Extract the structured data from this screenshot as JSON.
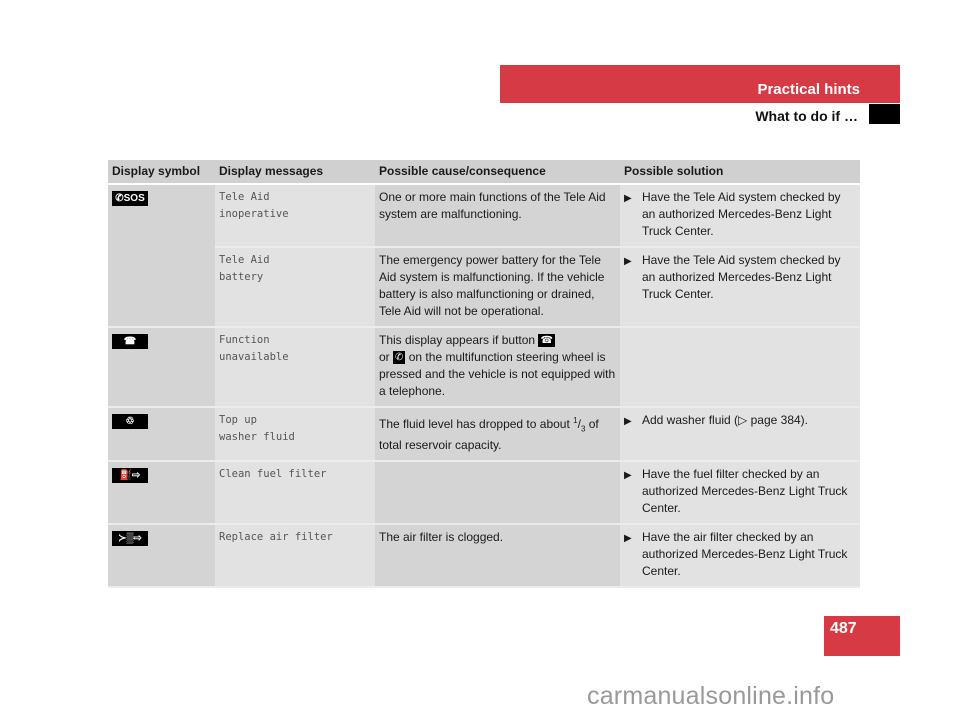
{
  "header": {
    "section_title": "Practical hints",
    "subtitle": "What to do if …"
  },
  "table": {
    "headers": [
      "Display symbol",
      "Display messages",
      "Possible cause/consequence",
      "Possible solution"
    ],
    "rows": [
      {
        "symbol": "phone-sos-icon",
        "symbol_text": "✆SOS",
        "message": "Tele Aid\ninoperative",
        "cause": "One or more main functions of the Tele Aid system are malfunctioning.",
        "solution": "Have the Tele Aid system checked by an authorized Mercedes-Benz Light Truck Center."
      },
      {
        "symbol": "",
        "message": "Tele Aid\nbattery",
        "cause": "The emergency power battery for the Tele Aid system is malfunctioning. If the vehicle battery is also malfunctioning or drained, Tele Aid will not be operational.",
        "solution": "Have the Tele Aid system checked by an authorized Mercedes-Benz Light Truck Center."
      },
      {
        "symbol": "phone-hangup-icon",
        "symbol_text": "☎",
        "message": "Function\nunavailable",
        "cause_parts": [
          "This display appears if button",
          "or",
          "on the multifunction steering wheel is pressed and the vehicle is not equipped with a telephone."
        ],
        "solution": ""
      },
      {
        "symbol": "washer-fluid-icon",
        "symbol_text": "♲",
        "message": "Top up\nwasher fluid",
        "cause_parts": [
          "The fluid level has dropped to about",
          "1",
          "3",
          "of total reservoir capacity."
        ],
        "solution": "Add washer fluid (▷ page 384)."
      },
      {
        "symbol": "fuel-filter-icon",
        "symbol_text": "⛽⇨",
        "message": "Clean fuel filter",
        "cause": "",
        "solution": "Have the fuel filter checked by an authorized Mercedes-Benz Light Truck Center."
      },
      {
        "symbol": "air-filter-icon",
        "symbol_text": "≻▒⇨",
        "message": "Replace air filter",
        "cause": "The air filter is clogged.",
        "solution": "Have the air filter checked by an authorized Mercedes-Benz Light Truck Center."
      }
    ]
  },
  "page_number": "487",
  "watermark": "carmanualsonline.info",
  "colors": {
    "accent": "#d63a45"
  }
}
